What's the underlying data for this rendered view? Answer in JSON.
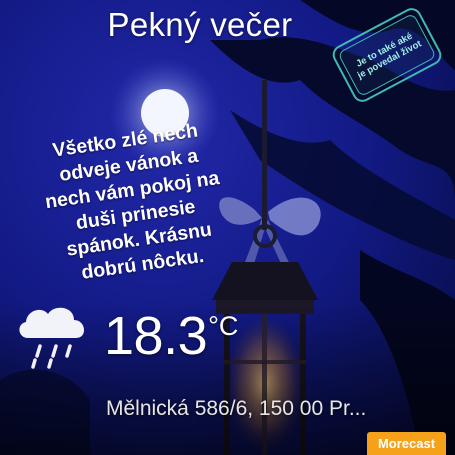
{
  "greeting": {
    "title": "Pekný večer"
  },
  "stamp": {
    "line1": "Je to také aké",
    "line2": "je povedal život"
  },
  "poem": {
    "lines": [
      "Všetko zlé nech",
      "odveje vánok a",
      "nech vám pokoj na",
      "duši prinesie",
      "spánok. Krásnu",
      "dobrú nôcku."
    ]
  },
  "weather": {
    "icon": "rain-cloud-icon",
    "temperature": "18.3",
    "unit": "°C",
    "location": "Mělnická 586/6, 150 00 Pr..."
  },
  "brand": {
    "label": "Morecast",
    "color": "#f5a21a"
  },
  "colors": {
    "night_sky": "#0b1160",
    "moon": "#f4f6ff",
    "stamp": "#3fb9b1"
  }
}
